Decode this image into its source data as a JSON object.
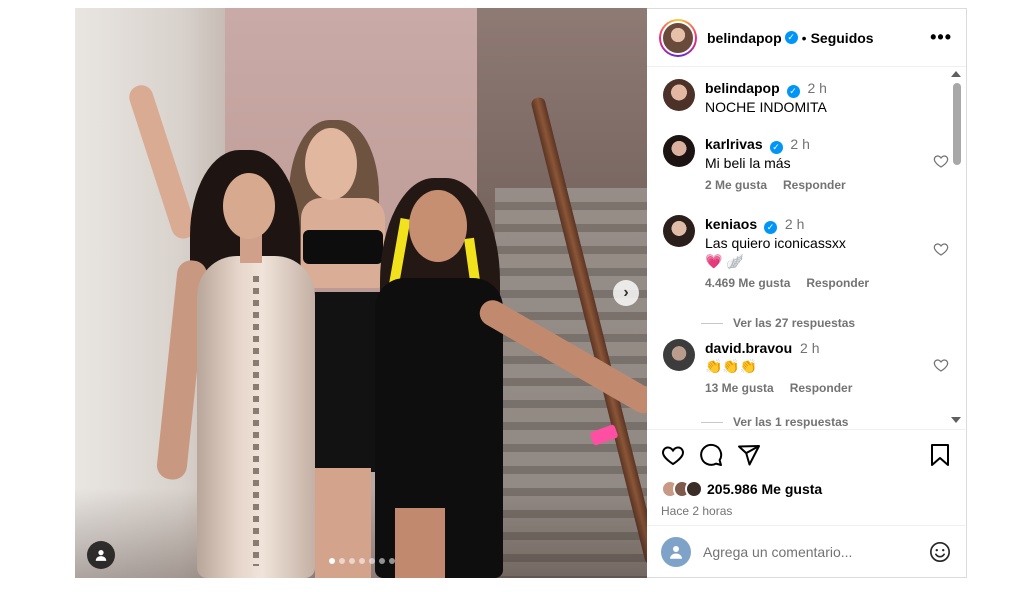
{
  "post": {
    "author": "belindapop",
    "follow_status": "Seguidos",
    "more_label": "•••",
    "carousel_dot_count": 7,
    "carousel_active_index": 0
  },
  "caption": {
    "username": "belindapop",
    "time": "2 h",
    "text": "NOCHE INDOMITA"
  },
  "comments": [
    {
      "username": "karlrivas",
      "time": "2 h",
      "text": "Mi beli la más",
      "likes": "2 Me gusta",
      "reply": "Responder"
    },
    {
      "username": "keniaos",
      "time": "2 h",
      "text": "Las quiero iconicassxx",
      "text2": "💗 🪽",
      "likes": "4.469 Me gusta",
      "reply": "Responder",
      "view_replies": "Ver las 27 respuestas"
    },
    {
      "username": "david.bravou",
      "time": "2 h",
      "text": "👏👏👏",
      "likes": "13 Me gusta",
      "reply": "Responder",
      "view_replies": "Ver las 1 respuestas"
    }
  ],
  "engagement": {
    "likes_label": "205.986 Me gusta",
    "posted": "Hace 2 horas"
  },
  "add_comment": {
    "placeholder": "Agrega un comentario..."
  },
  "icons": {
    "like": "heart-icon",
    "comment": "comment-bubble-icon",
    "share": "paper-plane-icon",
    "save": "bookmark-icon",
    "emoji": "smiley-icon",
    "next": "chevron-right-icon",
    "tags": "user-tag-icon",
    "verified": "verified-badge-icon"
  }
}
